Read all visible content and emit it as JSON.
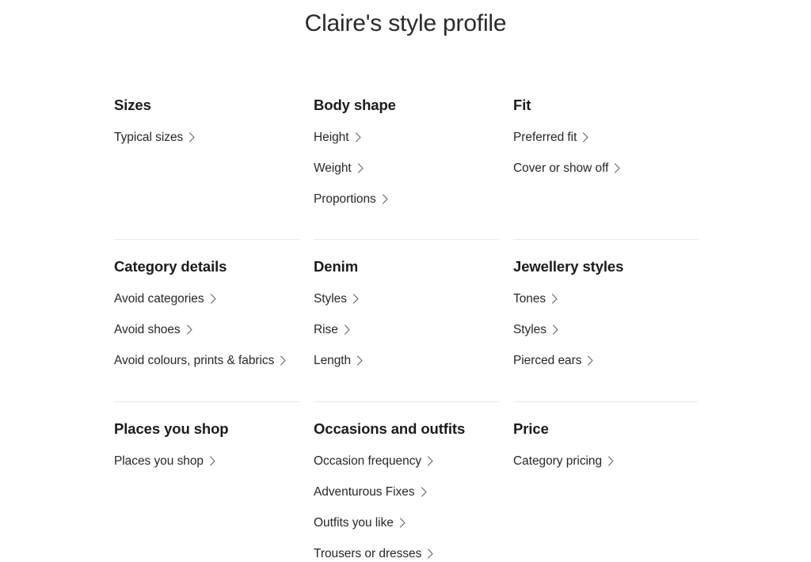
{
  "header": {
    "title": "Claire's style profile"
  },
  "colors": {
    "background": "#ffffff",
    "title_text": "#2b2a29",
    "heading_text": "#1c1b1a",
    "link_text": "#282726",
    "chevron": "#6b6a69",
    "divider": "#ebeaea"
  },
  "icons": {
    "chevron": "chevron-right-icon"
  },
  "rows": [
    {
      "divider_above": false,
      "columns": [
        {
          "title": "Sizes",
          "links": [
            {
              "label": "Typical sizes"
            }
          ]
        },
        {
          "title": "Body shape",
          "links": [
            {
              "label": "Height"
            },
            {
              "label": "Weight"
            },
            {
              "label": "Proportions"
            }
          ]
        },
        {
          "title": "Fit",
          "links": [
            {
              "label": "Preferred fit"
            },
            {
              "label": "Cover or show off"
            }
          ]
        }
      ]
    },
    {
      "divider_above": true,
      "columns": [
        {
          "title": "Category details",
          "links": [
            {
              "label": "Avoid categories"
            },
            {
              "label": "Avoid shoes"
            },
            {
              "label": "Avoid colours, prints & fabrics"
            }
          ]
        },
        {
          "title": "Denim",
          "links": [
            {
              "label": "Styles"
            },
            {
              "label": "Rise"
            },
            {
              "label": "Length"
            }
          ]
        },
        {
          "title": "Jewellery styles",
          "links": [
            {
              "label": "Tones"
            },
            {
              "label": "Styles"
            },
            {
              "label": "Pierced ears"
            }
          ]
        }
      ]
    },
    {
      "divider_above": true,
      "columns": [
        {
          "title": "Places you shop",
          "links": [
            {
              "label": "Places you shop"
            }
          ]
        },
        {
          "title": "Occasions and outfits",
          "links": [
            {
              "label": "Occasion frequency"
            },
            {
              "label": "Adventurous Fixes"
            },
            {
              "label": "Outfits you like"
            },
            {
              "label": "Trousers or dresses"
            }
          ]
        },
        {
          "title": "Price",
          "links": [
            {
              "label": "Category pricing"
            }
          ]
        }
      ]
    }
  ]
}
